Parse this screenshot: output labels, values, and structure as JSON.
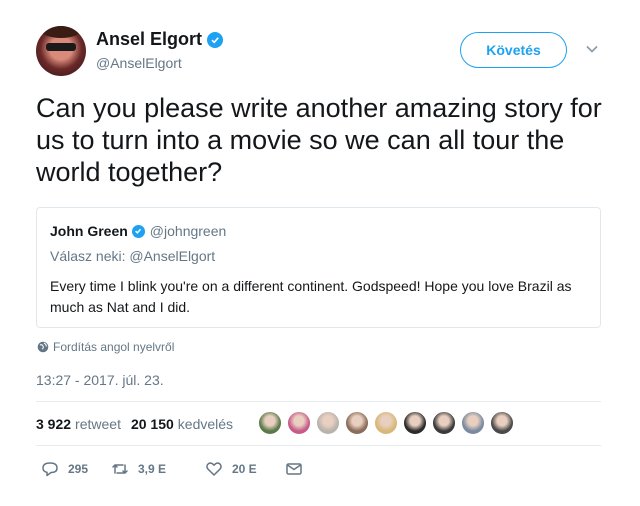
{
  "author": {
    "name": "Ansel Elgort",
    "handle": "@AnselElgort",
    "avatar_icon": "user-avatar"
  },
  "follow_button": {
    "label": "Követés"
  },
  "tweet": {
    "text": "Can you please write another amazing story for us to turn into a movie so we can all tour the world together?"
  },
  "quoted_tweet": {
    "name": "John Green",
    "handle": "@johngreen",
    "reply_to": "Válasz neki: @AnselElgort",
    "text": "Every time I blink you're on a different continent. Godspeed! Hope you love Brazil as much as Nat and I did."
  },
  "translate_label": "Fordítás angol nyelvről",
  "timestamp": "13:27 - 2017. júl. 23.",
  "stats": {
    "retweets_count": "3 922",
    "retweets_label": "retweet",
    "likes_count": "20 150",
    "likes_label": "kedvelés"
  },
  "likers": [
    {
      "color": "#5a7a4a"
    },
    {
      "color": "#c75a8a"
    },
    {
      "color": "#b9b3ad"
    },
    {
      "color": "#8a6d5a"
    },
    {
      "color": "#d8b878"
    },
    {
      "color": "#2b2b2b"
    },
    {
      "color": "#3a3a3a"
    },
    {
      "color": "#7a8aa0"
    },
    {
      "color": "#4a4a4a"
    }
  ],
  "actions": {
    "reply_count": "295",
    "retweet_count": "3,9 E",
    "like_count": "20 E"
  },
  "colors": {
    "accent": "#1da1f2",
    "muted": "#657786",
    "border": "#e1e8ed"
  }
}
